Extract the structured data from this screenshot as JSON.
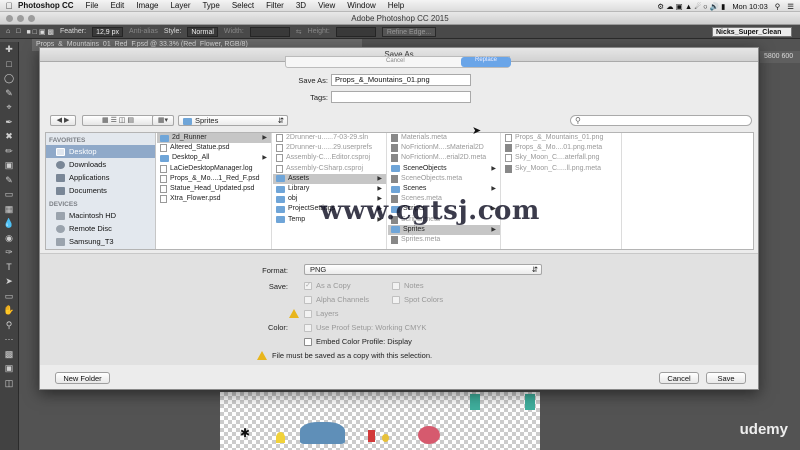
{
  "menubar": {
    "app": "Photoshop CC",
    "items": [
      "File",
      "Edit",
      "Image",
      "Layer",
      "Type",
      "Select",
      "Filter",
      "3D",
      "View",
      "Window",
      "Help"
    ],
    "clock": "Mon 10:03"
  },
  "window": {
    "title": "Adobe Photoshop CC 2015"
  },
  "options": {
    "feather_label": "Feather:",
    "feather_value": "12,9 px",
    "antialias": "Anti-alias",
    "style_label": "Style:",
    "style_value": "Normal",
    "width_label": "Width:",
    "height_label": "Height:",
    "refine": "Refine Edge...",
    "workspace": "Nicks_Super_Clean"
  },
  "doc_tab": "Props_&_Mountains_01_Red_F.psd @ 33.3% (Red_Flower, RGB/8)",
  "ruler_value": "5800 600",
  "dialog": {
    "title": "Save As",
    "ghost": {
      "cancel": "Cancel",
      "replace": "Replace"
    },
    "save_as_label": "Save As:",
    "save_as_value": "Props_&_Mountains_01.png",
    "tags_label": "Tags:",
    "tags_value": "",
    "folder": "Sprites",
    "sidebar": {
      "favorites_header": "FAVORITES",
      "favorites": [
        "Desktop",
        "Downloads",
        "Applications",
        "Documents"
      ],
      "devices_header": "DEVICES",
      "devices": [
        "Macintosh HD",
        "Remote Disc",
        "Samsung_T3"
      ]
    },
    "col1": [
      "2d_Runner",
      "Altered_Statue.psd",
      "Desktop_All",
      "LaCieDesktopManager.log",
      "Props_&_Mo....1_Red_F.psd",
      "Statue_Head_Updated.psd",
      "Xtra_Flower.psd"
    ],
    "col2": [
      "2Drunner-u......7-03-29.sln",
      "2Drunner-u......29.userprefs",
      "Assembly-C....Editor.csproj",
      "Assembly-CSharp.csproj",
      "Assets",
      "Library",
      "obj",
      "ProjectSettings",
      "Temp"
    ],
    "col3": [
      "Materials.meta",
      "NoFrictionM....sMaterial2D",
      "NoFrictionM....erial2D.meta",
      "SceneObjects",
      "SceneObjects.meta",
      "Scenes",
      "Scenes.meta",
      "Scripts",
      "Scripts.meta",
      "Sprites",
      "Sprites.meta"
    ],
    "col4": [
      "Props_&_Mountains_01.png",
      "Props_&_Mo....01.png.meta",
      "Sky_Moon_C....aterfall.png",
      "Sky_Moon_C.....ll.png.meta"
    ],
    "format_label": "Format:",
    "format_value": "PNG",
    "save_label": "Save:",
    "as_copy": "As a Copy",
    "notes": "Notes",
    "alpha": "Alpha Channels",
    "spot": "Spot Colors",
    "layers": "Layers",
    "color_label": "Color:",
    "proof": "Use Proof Setup:  Working CMYK",
    "embed": "Embed Color Profile:  Display",
    "warning": "File must be saved as a copy with this selection.",
    "new_folder": "New Folder",
    "cancel": "Cancel",
    "save": "Save"
  },
  "watermark": "www.cgtsj.com",
  "udemy": "udemy"
}
